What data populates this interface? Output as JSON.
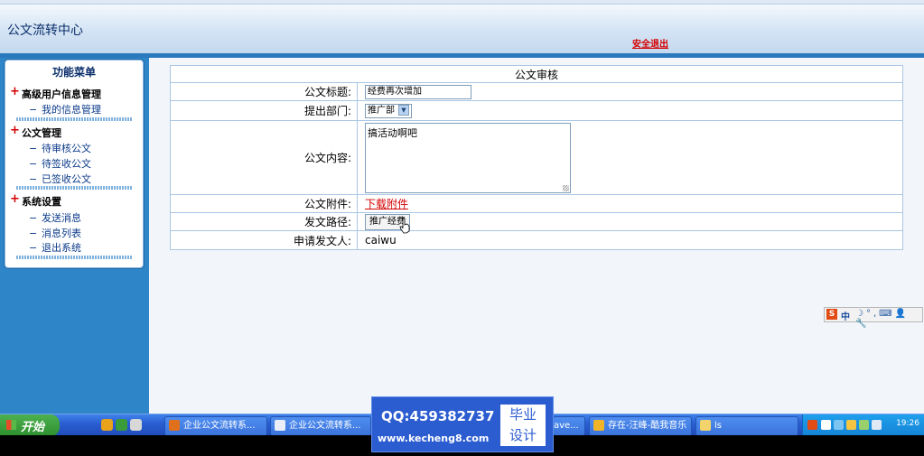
{
  "header": {
    "app_title": "公文流转中心",
    "logout_label": "安全退出"
  },
  "sidebar": {
    "title": "功能菜单",
    "groups": [
      {
        "label": "高级用户信息管理",
        "items": [
          "我的信息管理"
        ]
      },
      {
        "label": "公文管理",
        "items": [
          "待审核公文",
          "待签收公文",
          "已签收公文"
        ]
      },
      {
        "label": "系统设置",
        "items": [
          "发送消息",
          "消息列表",
          "退出系统"
        ]
      }
    ]
  },
  "form": {
    "title": "公文审核",
    "rows": {
      "doc_title": {
        "label": "公文标题:",
        "value": "经费再次增加"
      },
      "department": {
        "label": "提出部门:",
        "value": "推广部"
      },
      "content": {
        "label": "公文内容:",
        "value": "搞活动啊吧"
      },
      "attachment": {
        "label": "公文附件:",
        "link": "下载附件"
      },
      "route": {
        "label": "发文路径:",
        "value": "推广经费"
      },
      "applicant": {
        "label": "申请发文人:",
        "value": "caiwu"
      }
    }
  },
  "ime_bar": {
    "mode_label": "中",
    "rest_icons": "☽°,⌨👤🔧"
  },
  "taskbar": {
    "start_label": "开始",
    "buttons": [
      {
        "label": "企业公文流转系..."
      },
      {
        "label": "企业公文流转系..."
      },
      {
        "label": "ave..."
      },
      {
        "label": "存在-汪峰-酷我音乐"
      },
      {
        "label": "ls"
      }
    ],
    "clock": "19:26"
  },
  "watermark": {
    "qq": "QQ:459382737",
    "url": "www.kecheng8.com",
    "badge_line1": "毕业",
    "badge_line2": "设计"
  },
  "colors": {
    "sidebar_blue": "#2e86c8",
    "accent_red": "#d40000",
    "taskbar_blue": "#2b5fd3"
  }
}
